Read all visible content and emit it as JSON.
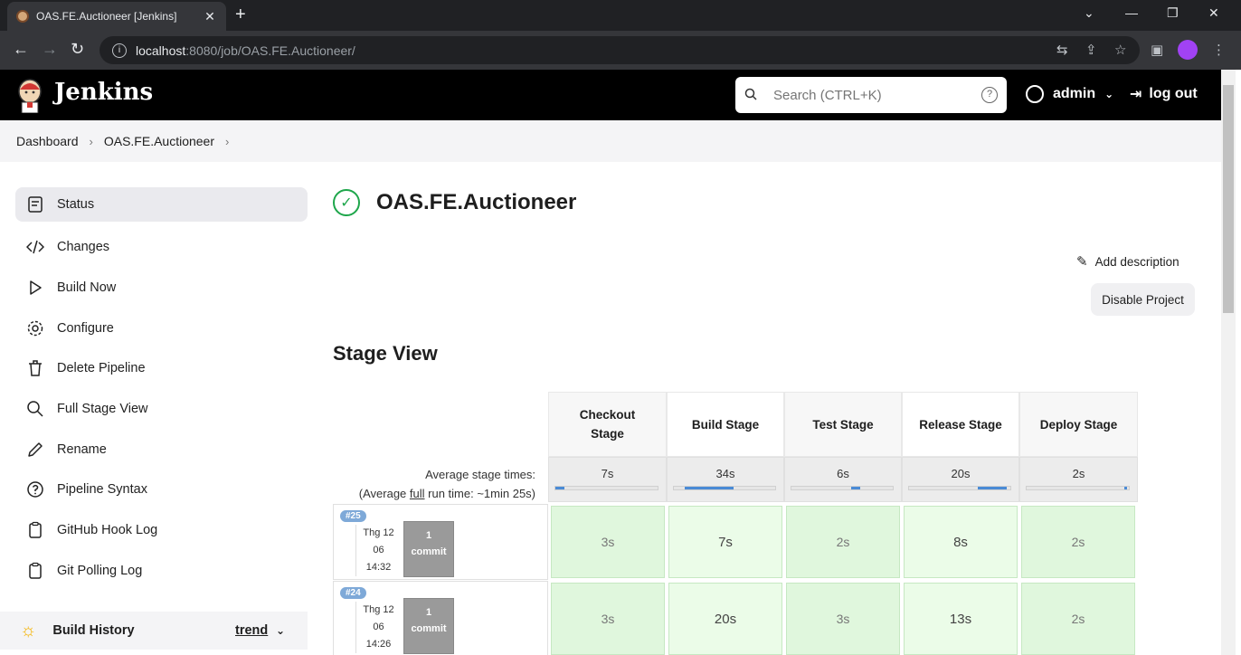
{
  "browser": {
    "tab_title": "OAS.FE.Auctioneer [Jenkins]",
    "url_host": "localhost",
    "url_path": ":8080/job/OAS.FE.Auctioneer/"
  },
  "header": {
    "brand": "Jenkins",
    "search_placeholder": "Search (CTRL+K)",
    "user": "admin",
    "logout": "log out"
  },
  "breadcrumb": [
    "Dashboard",
    "OAS.FE.Auctioneer"
  ],
  "sidebar": {
    "items": [
      {
        "label": "Status",
        "icon": "status-icon"
      },
      {
        "label": "Changes",
        "icon": "code-icon"
      },
      {
        "label": "Build Now",
        "icon": "play-icon"
      },
      {
        "label": "Configure",
        "icon": "gear-icon"
      },
      {
        "label": "Delete Pipeline",
        "icon": "trash-icon"
      },
      {
        "label": "Full Stage View",
        "icon": "search-icon"
      },
      {
        "label": "Rename",
        "icon": "pencil-icon"
      },
      {
        "label": "Pipeline Syntax",
        "icon": "help-icon"
      },
      {
        "label": "GitHub Hook Log",
        "icon": "clipboard-icon"
      },
      {
        "label": "Git Polling Log",
        "icon": "clipboard-icon"
      }
    ],
    "build_history": "Build History",
    "trend": "trend"
  },
  "main": {
    "project_title": "OAS.FE.Auctioneer",
    "add_description": "Add description",
    "disable_project": "Disable Project",
    "stage_view_title": "Stage View",
    "avg_label_1": "Average stage times:",
    "avg_label_2_pre": "(Average ",
    "avg_label_2_full": "full",
    "avg_label_2_post": " run time: ~1min 25s)"
  },
  "stages": [
    {
      "name_line1": "Checkout",
      "name_line2": "Stage",
      "avg": "7s"
    },
    {
      "name_line1": "Build Stage",
      "name_line2": "",
      "avg": "34s"
    },
    {
      "name_line1": "Test Stage",
      "name_line2": "",
      "avg": "6s"
    },
    {
      "name_line1": "Release Stage",
      "name_line2": "",
      "avg": "20s"
    },
    {
      "name_line1": "Deploy Stage",
      "name_line2": "",
      "avg": "2s"
    }
  ],
  "builds": [
    {
      "badge": "#25",
      "date1": "Thg 12",
      "date2": "06",
      "time": "14:32",
      "commits": "1",
      "commit_label": "commit",
      "times": [
        "3s",
        "7s",
        "2s",
        "8s",
        "2s"
      ]
    },
    {
      "badge": "#24",
      "date1": "Thg 12",
      "date2": "06",
      "time": "14:26",
      "commits": "1",
      "commit_label": "commit",
      "times": [
        "3s",
        "20s",
        "3s",
        "13s",
        "2s"
      ]
    }
  ],
  "colors": {
    "success": "#1ea64b",
    "stage_success_bg": "#e0f7dd",
    "progress_blue": "#4a8bd6"
  }
}
